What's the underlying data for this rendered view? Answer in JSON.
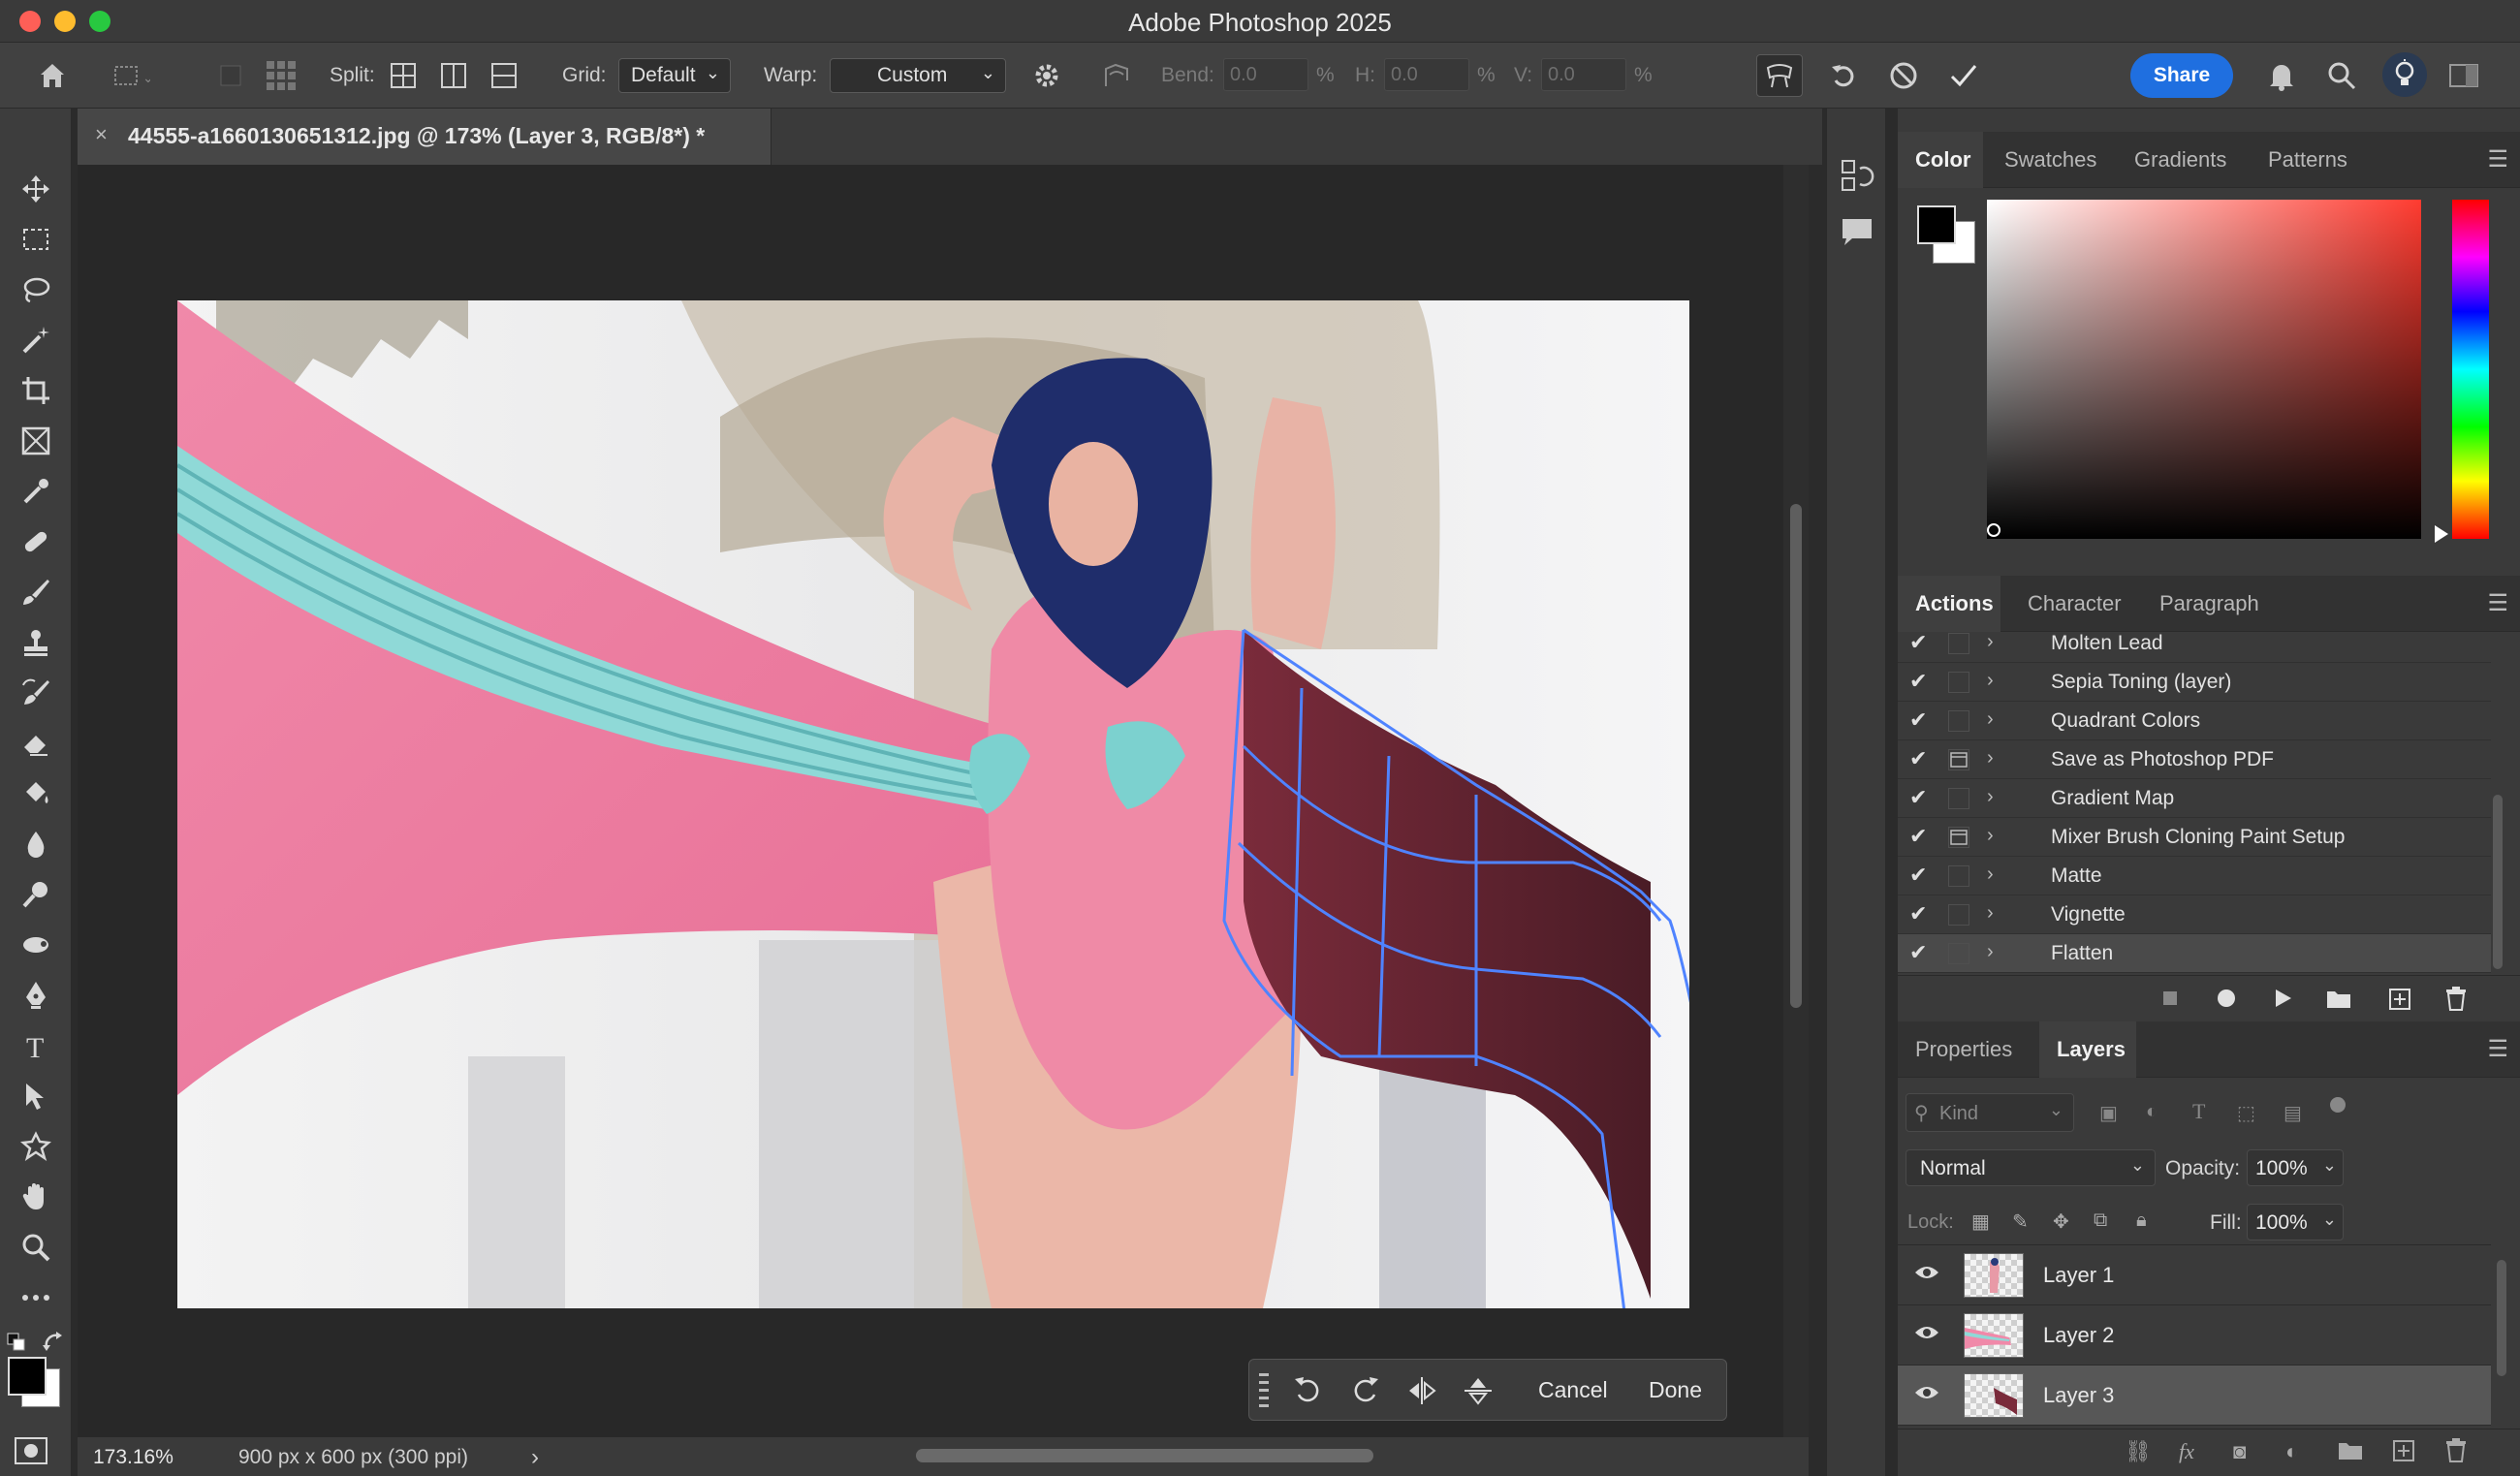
{
  "window": {
    "title": "Adobe Photoshop 2025",
    "colors": {
      "close": "#fe5f57",
      "minimize": "#febc2e",
      "zoom": "#28c840"
    }
  },
  "options_bar": {
    "split_label": "Split:",
    "grid_label": "Grid:",
    "grid_value": "Default",
    "warp_label": "Warp:",
    "warp_value": "Custom",
    "bend_label": "Bend:",
    "bend_value": "0.0",
    "h_label": "H:",
    "h_value": "0.0",
    "v_label": "V:",
    "v_value": "0.0",
    "percent": "%",
    "share_label": "Share",
    "accent_color": "#1f6fe0"
  },
  "document_tab": {
    "close_glyph": "×",
    "name": "44555-a1660130651312.jpg @ 173% (Layer 3, RGB/8*) *"
  },
  "status_bar": {
    "zoom": "173.16%",
    "doc_info": "900 px x 600 px (300 ppi)",
    "more_glyph": "›"
  },
  "warp_bar": {
    "cancel_label": "Cancel",
    "done_label": "Done"
  },
  "color_panel": {
    "tabs": [
      "Color",
      "Swatches",
      "Gradients",
      "Patterns"
    ],
    "active_tab": "Color",
    "foreground": "#000000",
    "background": "#ffffff",
    "hue_color": "#ff3b30"
  },
  "actions_panel": {
    "tabs": [
      "Actions",
      "Character",
      "Paragraph"
    ],
    "active_tab": "Actions",
    "items": [
      {
        "label": "Molten Lead",
        "dialog": false
      },
      {
        "label": "Sepia Toning (layer)",
        "dialog": false
      },
      {
        "label": "Quadrant Colors",
        "dialog": false
      },
      {
        "label": "Save as Photoshop PDF",
        "dialog": true
      },
      {
        "label": "Gradient Map",
        "dialog": false
      },
      {
        "label": "Mixer Brush Cloning Paint Setup",
        "dialog": true
      },
      {
        "label": "Matte",
        "dialog": false
      },
      {
        "label": "Vignette",
        "dialog": false
      },
      {
        "label": "Flatten",
        "dialog": false
      }
    ]
  },
  "layers_panel": {
    "tabs": [
      "Properties",
      "Layers"
    ],
    "active_tab": "Layers",
    "filter_placeholder": "Kind",
    "blend_mode": "Normal",
    "opacity_label": "Opacity:",
    "opacity_value": "100%",
    "lock_label": "Lock:",
    "fill_label": "Fill:",
    "fill_value": "100%",
    "layers": [
      {
        "name": "Layer 1",
        "selected": false
      },
      {
        "name": "Layer 2",
        "selected": false
      },
      {
        "name": "Layer 3",
        "selected": true
      }
    ]
  }
}
